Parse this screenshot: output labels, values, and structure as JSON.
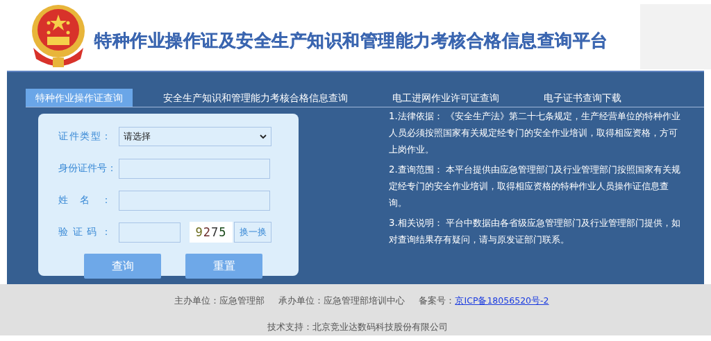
{
  "header": {
    "title": "特种作业操作证及安全生产知识和管理能力考核合格信息查询平台"
  },
  "tabs": [
    {
      "label": "特种作业操作证查询",
      "selected": true
    },
    {
      "label": "安全生产知识和管理能力考核合格信息查询",
      "selected": false
    },
    {
      "label": "电工进网作业许可证查询",
      "selected": false
    },
    {
      "label": "电子证书查询下载",
      "selected": false
    }
  ],
  "form": {
    "fields": [
      {
        "kind": "select",
        "label": "证件类型：",
        "value": "请选择"
      },
      {
        "kind": "text",
        "label": "身份证件号："
      },
      {
        "kind": "text",
        "label": "姓名："
      },
      {
        "kind": "captcha",
        "label": "验证码：",
        "captcha": "9275",
        "refresh": "换一换"
      }
    ],
    "buttons": [
      "查询",
      "重置"
    ]
  },
  "notes": [
    "1.法律依据：  《安全生产法》第二十七条规定，生产经营单位的特种作业人员必须按照国家有关规定经专门的安全作业培训，取得相应资格，方可上岗作业。",
    "2.查询范围：  本平台提供由应急管理部门及行业管理部门按照国家有关规定经专门的安全作业培训，取得相应资格的特种作业人员操作证信息查询。",
    "3.相关说明：  平台中数据由各省级应急管理部门及行业管理部门提供，如对查询结果存有疑问，请与原发证部门联系。"
  ],
  "footer": {
    "sponsor": "主办单位：应急管理部",
    "organizer": "承办单位：应急管理部培训中心",
    "record_label": "备案号：",
    "record_link": "京ICP备18056520号-2",
    "support": "技术支持：北京竞业达数码科技股份有限公司"
  }
}
